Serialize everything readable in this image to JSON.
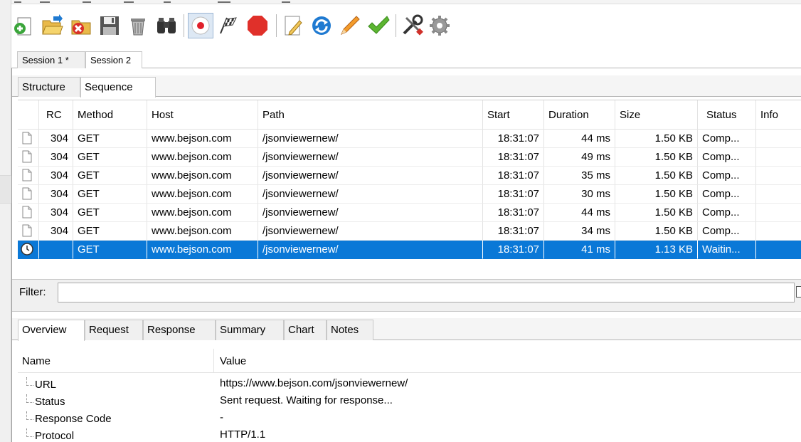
{
  "menubar": {
    "items": [
      "",
      "",
      "",
      "",
      "",
      "",
      ""
    ]
  },
  "toolbar": {
    "buttons": [
      {
        "name": "new-session-icon"
      },
      {
        "name": "open-icon"
      },
      {
        "name": "close-session-icon"
      },
      {
        "name": "save-icon"
      },
      {
        "name": "clear-icon"
      },
      {
        "name": "find-icon"
      },
      {
        "name": "record-icon",
        "pressed": true
      },
      {
        "name": "throttle-flag-icon"
      },
      {
        "name": "stop-icon"
      },
      {
        "name": "edit-request-icon"
      },
      {
        "name": "repeat-icon"
      },
      {
        "name": "validate-pencil-icon"
      },
      {
        "name": "validate-check-icon"
      },
      {
        "name": "tools-icon"
      },
      {
        "name": "settings-gear-icon"
      }
    ]
  },
  "session_tabs": [
    {
      "label": "Session 1 *",
      "active": false
    },
    {
      "label": "Session 2",
      "active": true
    }
  ],
  "view_tabs": [
    {
      "label": "Structure",
      "active": false
    },
    {
      "label": "Sequence",
      "active": true
    }
  ],
  "grid": {
    "columns": [
      "",
      "RC",
      "Method",
      "Host",
      "Path",
      "Start",
      "Duration",
      "Size",
      "Status",
      "Info"
    ],
    "rows": [
      {
        "icon": "document-icon",
        "rc": "304",
        "method": "GET",
        "host": "www.bejson.com",
        "path": "/jsonviewernew/",
        "start": "18:31:07",
        "duration": "44 ms",
        "size": "1.50 KB",
        "status": "Comp...",
        "info": ""
      },
      {
        "icon": "document-icon",
        "rc": "304",
        "method": "GET",
        "host": "www.bejson.com",
        "path": "/jsonviewernew/",
        "start": "18:31:07",
        "duration": "49 ms",
        "size": "1.50 KB",
        "status": "Comp...",
        "info": ""
      },
      {
        "icon": "document-icon",
        "rc": "304",
        "method": "GET",
        "host": "www.bejson.com",
        "path": "/jsonviewernew/",
        "start": "18:31:07",
        "duration": "35 ms",
        "size": "1.50 KB",
        "status": "Comp...",
        "info": ""
      },
      {
        "icon": "document-icon",
        "rc": "304",
        "method": "GET",
        "host": "www.bejson.com",
        "path": "/jsonviewernew/",
        "start": "18:31:07",
        "duration": "30 ms",
        "size": "1.50 KB",
        "status": "Comp...",
        "info": ""
      },
      {
        "icon": "document-icon",
        "rc": "304",
        "method": "GET",
        "host": "www.bejson.com",
        "path": "/jsonviewernew/",
        "start": "18:31:07",
        "duration": "44 ms",
        "size": "1.50 KB",
        "status": "Comp...",
        "info": ""
      },
      {
        "icon": "document-icon",
        "rc": "304",
        "method": "GET",
        "host": "www.bejson.com",
        "path": "/jsonviewernew/",
        "start": "18:31:07",
        "duration": "34 ms",
        "size": "1.50 KB",
        "status": "Comp...",
        "info": ""
      },
      {
        "icon": "clock-icon",
        "rc": "",
        "method": "GET",
        "host": "www.bejson.com",
        "path": "/jsonviewernew/",
        "start": "18:31:07",
        "duration": "41 ms",
        "size": "1.13 KB",
        "status": "Waitin...",
        "info": "",
        "selected": true
      }
    ]
  },
  "filter": {
    "label": "Filter:",
    "value": ""
  },
  "detail_tabs": [
    {
      "label": "Overview",
      "active": true
    },
    {
      "label": "Request",
      "active": false
    },
    {
      "label": "Response",
      "active": false
    },
    {
      "label": "Summary",
      "active": false
    },
    {
      "label": "Chart",
      "active": false
    },
    {
      "label": "Notes",
      "active": false
    }
  ],
  "overview": {
    "name_header": "Name",
    "value_header": "Value",
    "rows": [
      {
        "name": "URL",
        "value": "https://www.bejson.com/jsonviewernew/"
      },
      {
        "name": "Status",
        "value": "Sent request. Waiting for response..."
      },
      {
        "name": "Response Code",
        "value": "-"
      },
      {
        "name": "Protocol",
        "value": "HTTP/1.1"
      }
    ]
  },
  "colors": {
    "selection": "#0a78d7",
    "record_red": "#e0202a"
  }
}
